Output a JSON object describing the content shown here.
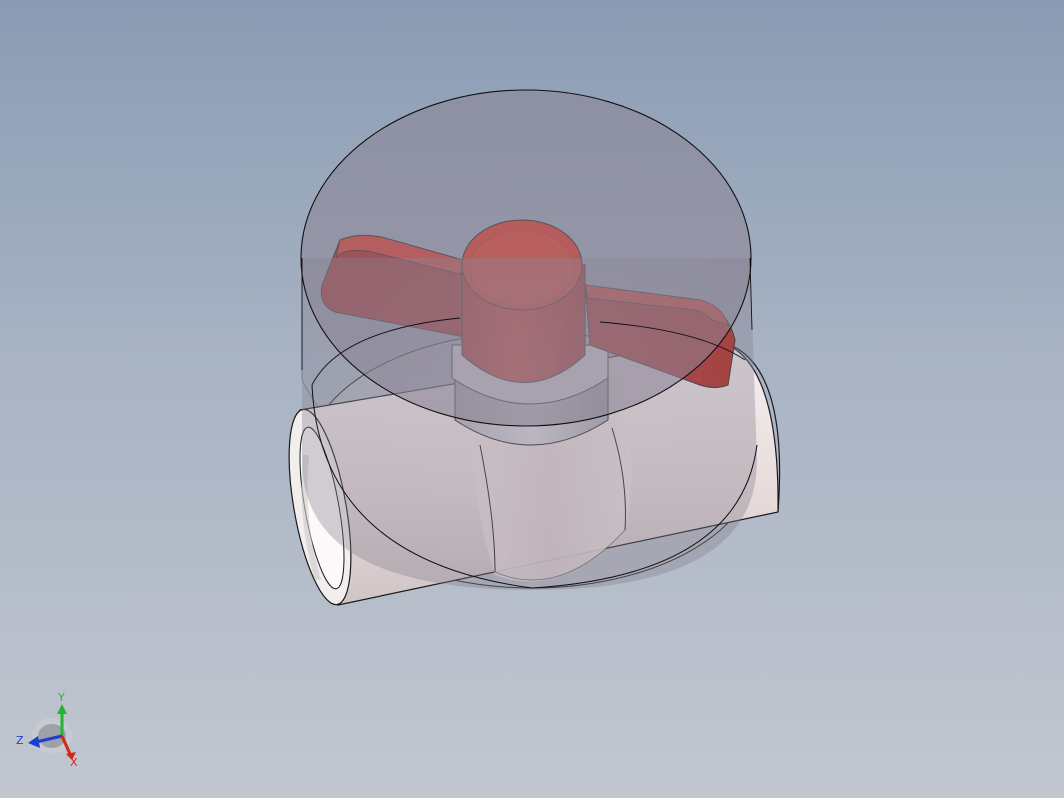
{
  "viewport": {
    "background_top": "#8a9cb4",
    "background_bottom": "#c2c7d0"
  },
  "model": {
    "body_color": "#e9dddd",
    "handle_color": "#e2281a",
    "transparent_envelope_color": "#8e8898"
  },
  "triad": {
    "axis_x_label": "X",
    "axis_y_label": "Y",
    "axis_z_label": "Z",
    "x_color": "#d4261c",
    "y_color": "#21b530",
    "z_color": "#1b3fd0"
  }
}
